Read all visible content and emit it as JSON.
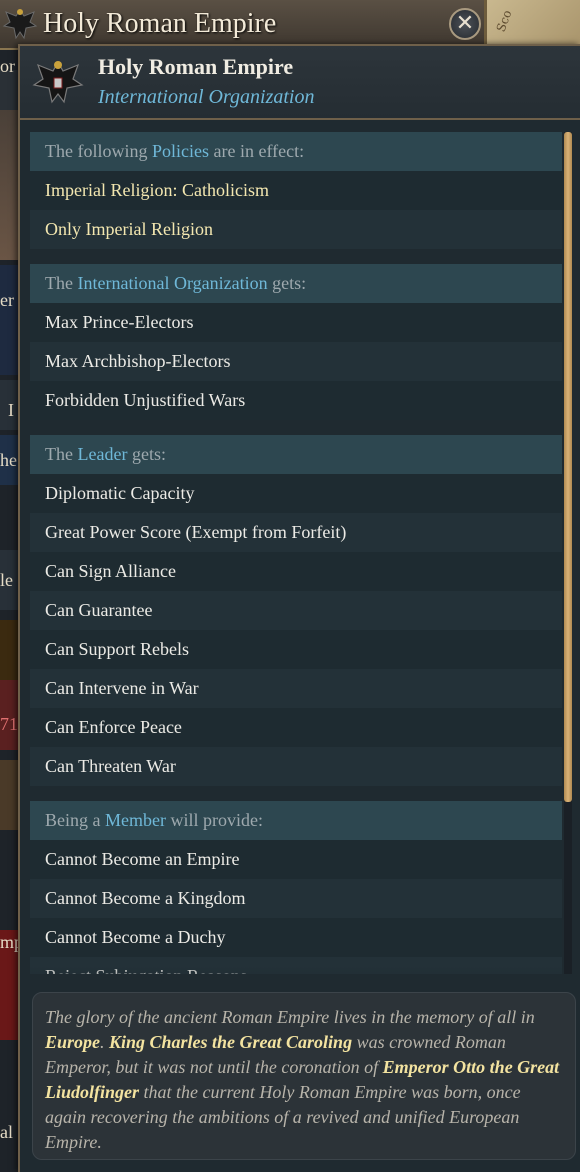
{
  "window": {
    "title": "Holy Roman Empire",
    "close_glyph": "✕",
    "map_label": "Sco"
  },
  "left_strip": {
    "fragments": [
      "or",
      "er",
      "I",
      "he",
      "le",
      "71",
      "mp",
      "al"
    ]
  },
  "tooltip": {
    "title": "Holy Roman Empire",
    "subtitle": "International Organization",
    "sections": [
      {
        "header_before": "The following ",
        "header_highlight": "Policies",
        "header_after": " are in effect:",
        "rows": [
          "Imperial Religion: Catholicism",
          "Only Imperial Religion"
        ]
      },
      {
        "header_before": "The ",
        "header_highlight": "International Organization",
        "header_after": " gets:",
        "rows": [
          "Max Prince-Electors",
          "Max Archbishop-Electors",
          "Forbidden Unjustified Wars"
        ]
      },
      {
        "header_before": "The ",
        "header_highlight": "Leader",
        "header_after": " gets:",
        "rows": [
          "Diplomatic Capacity",
          "Great Power Score (Exempt from Forfeit)",
          "Can Sign Alliance",
          "Can Guarantee",
          "Can Support Rebels",
          "Can Intervene in War",
          "Can Enforce Peace",
          "Can Threaten War"
        ]
      },
      {
        "header_before": "Being a ",
        "header_highlight": "Member",
        "header_after": " will provide:",
        "rows": [
          "Cannot Become an Empire",
          "Cannot Become a Kingdom",
          "Cannot Become a Duchy",
          "Reject Subjugation Reasons"
        ]
      }
    ],
    "description": {
      "part1": "The glory of the ancient Roman Empire lives in the memory of all in ",
      "bold1": "Europe",
      "part2": ". ",
      "bold2": "King Charles the Great Caroling",
      "part3": " was crowned Roman Emperor, but it was not until the coronation of ",
      "bold3": "Emperor Otto the Great Liudolfinger",
      "part4": " that the current Holy Roman Empire was born, once again recovering the ambitions of a revived and unified European Empire."
    }
  },
  "colors": {
    "highlight_blue": "#6fb8d8",
    "policy_yellow": "#f3e7b0",
    "section_header_bg": "#2d4750",
    "scroll_thumb": "#d9b276"
  },
  "icons": [
    "imperial-eagle-icon",
    "close-icon"
  ]
}
